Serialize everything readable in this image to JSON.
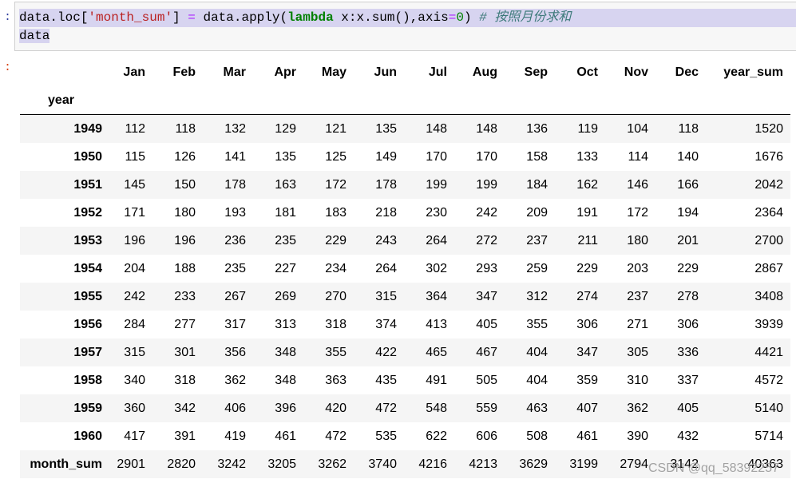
{
  "notebook": {
    "in_prompt": ":",
    "out_prompt": ":",
    "code": {
      "line1": {
        "t1": "data.loc[",
        "t2": "'month_sum'",
        "t3": "] ",
        "t4": "=",
        "t5": " data.apply(",
        "t6": "lambda",
        "t7": " x:x.sum(),axis",
        "t8": "=",
        "t9": "0",
        "t10": ") ",
        "t11": "# 按照月份求和"
      },
      "line2": "data"
    }
  },
  "table": {
    "columns": [
      "Jan",
      "Feb",
      "Mar",
      "Apr",
      "May",
      "Jun",
      "Jul",
      "Aug",
      "Sep",
      "Oct",
      "Nov",
      "Dec",
      "year_sum"
    ],
    "index_name": "year",
    "rows": [
      {
        "label": "1949",
        "values": [
          "112",
          "118",
          "132",
          "129",
          "121",
          "135",
          "148",
          "148",
          "136",
          "119",
          "104",
          "118",
          "1520"
        ]
      },
      {
        "label": "1950",
        "values": [
          "115",
          "126",
          "141",
          "135",
          "125",
          "149",
          "170",
          "170",
          "158",
          "133",
          "114",
          "140",
          "1676"
        ]
      },
      {
        "label": "1951",
        "values": [
          "145",
          "150",
          "178",
          "163",
          "172",
          "178",
          "199",
          "199",
          "184",
          "162",
          "146",
          "166",
          "2042"
        ]
      },
      {
        "label": "1952",
        "values": [
          "171",
          "180",
          "193",
          "181",
          "183",
          "218",
          "230",
          "242",
          "209",
          "191",
          "172",
          "194",
          "2364"
        ]
      },
      {
        "label": "1953",
        "values": [
          "196",
          "196",
          "236",
          "235",
          "229",
          "243",
          "264",
          "272",
          "237",
          "211",
          "180",
          "201",
          "2700"
        ]
      },
      {
        "label": "1954",
        "values": [
          "204",
          "188",
          "235",
          "227",
          "234",
          "264",
          "302",
          "293",
          "259",
          "229",
          "203",
          "229",
          "2867"
        ]
      },
      {
        "label": "1955",
        "values": [
          "242",
          "233",
          "267",
          "269",
          "270",
          "315",
          "364",
          "347",
          "312",
          "274",
          "237",
          "278",
          "3408"
        ]
      },
      {
        "label": "1956",
        "values": [
          "284",
          "277",
          "317",
          "313",
          "318",
          "374",
          "413",
          "405",
          "355",
          "306",
          "271",
          "306",
          "3939"
        ]
      },
      {
        "label": "1957",
        "values": [
          "315",
          "301",
          "356",
          "348",
          "355",
          "422",
          "465",
          "467",
          "404",
          "347",
          "305",
          "336",
          "4421"
        ]
      },
      {
        "label": "1958",
        "values": [
          "340",
          "318",
          "362",
          "348",
          "363",
          "435",
          "491",
          "505",
          "404",
          "359",
          "310",
          "337",
          "4572"
        ]
      },
      {
        "label": "1959",
        "values": [
          "360",
          "342",
          "406",
          "396",
          "420",
          "472",
          "548",
          "559",
          "463",
          "407",
          "362",
          "405",
          "5140"
        ]
      },
      {
        "label": "1960",
        "values": [
          "417",
          "391",
          "419",
          "461",
          "472",
          "535",
          "622",
          "606",
          "508",
          "461",
          "390",
          "432",
          "5714"
        ]
      },
      {
        "label": "month_sum",
        "values": [
          "2901",
          "2820",
          "3242",
          "3205",
          "3262",
          "3740",
          "4216",
          "4213",
          "3629",
          "3199",
          "2794",
          "3142",
          "40363"
        ]
      }
    ]
  },
  "watermark": "CSDN @qq_58392257"
}
